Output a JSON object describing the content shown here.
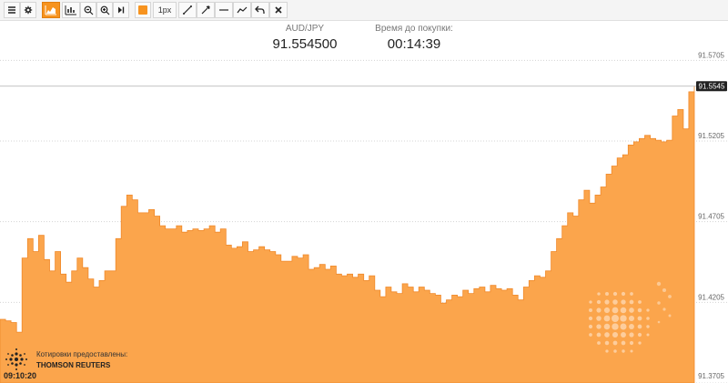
{
  "toolbar": {
    "items": [
      {
        "name": "menu-button",
        "icon": "menu-icon"
      },
      {
        "name": "settings-button",
        "icon": "gear-icon"
      },
      {
        "name": "area-chart-button",
        "icon": "area-chart-icon",
        "active": true
      },
      {
        "name": "bar-chart-button",
        "icon": "bar-chart-icon"
      },
      {
        "name": "zoom-out-button",
        "icon": "zoom-out-icon"
      },
      {
        "name": "zoom-in-button",
        "icon": "zoom-in-icon"
      },
      {
        "name": "skip-to-end-button",
        "icon": "skip-end-icon"
      },
      {
        "name": "color-picker-button",
        "icon": "color-swatch-icon",
        "color": "#f7931e"
      },
      {
        "name": "line-width-button",
        "label": "1px"
      },
      {
        "name": "draw-line-button",
        "icon": "line-icon"
      },
      {
        "name": "draw-ray-button",
        "icon": "ray-icon"
      },
      {
        "name": "horizontal-line-button",
        "icon": "horizontal-line-icon"
      },
      {
        "name": "trend-line-button",
        "icon": "trend-icon"
      },
      {
        "name": "undo-button",
        "icon": "undo-icon"
      },
      {
        "name": "clear-button",
        "icon": "close-icon"
      }
    ],
    "line_width_label": "1px"
  },
  "header": {
    "pair_label": "AUD/JPY",
    "price": "91.554500",
    "timer_label": "Время до покупки:",
    "timer": "00:14:39"
  },
  "credit": {
    "line1": "Котировки предоставлены:",
    "line2": "THOMSON REUTERS"
  },
  "clock": "09:10:20",
  "current_price_tag": "91.5545",
  "colors": {
    "accent": "#f7931e",
    "area_fill": "#fba54c",
    "area_stroke": "#f0892a"
  },
  "chart_data": {
    "type": "area",
    "series": [
      {
        "values": [
          91.41,
          91.409,
          91.408,
          91.402,
          91.448,
          91.46,
          91.452,
          91.462,
          91.447,
          91.44,
          91.452,
          91.438,
          91.433,
          91.44,
          91.448,
          91.442,
          91.435,
          91.43,
          91.434,
          91.44,
          91.44,
          91.46,
          91.48,
          91.487,
          91.484,
          91.476,
          91.476,
          91.478,
          91.474,
          91.468,
          91.466,
          91.466,
          91.468,
          91.464,
          91.465,
          91.466,
          91.465,
          91.466,
          91.468,
          91.464,
          91.466,
          91.456,
          91.454,
          91.455,
          91.458,
          91.452,
          91.453,
          91.455,
          91.453,
          91.452,
          91.45,
          91.446,
          91.446,
          91.449,
          91.448,
          91.45,
          91.441,
          91.442,
          91.444,
          91.441,
          91.443,
          91.438,
          91.437,
          91.438,
          91.436,
          91.438,
          91.434,
          91.437,
          91.428,
          91.424,
          91.43,
          91.427,
          91.426,
          91.432,
          91.43,
          91.427,
          91.43,
          91.428,
          91.426,
          91.425,
          91.42,
          91.422,
          91.425,
          91.424,
          91.428,
          91.426,
          91.429,
          91.43,
          91.427,
          91.431,
          91.429,
          91.428,
          91.429,
          91.425,
          91.422,
          91.43,
          91.434,
          91.437,
          91.436,
          91.44,
          91.452,
          91.46,
          91.468,
          91.476,
          91.474,
          91.484,
          91.49,
          91.482,
          91.487,
          91.492,
          91.5,
          91.505,
          91.51,
          91.512,
          91.518,
          91.52,
          91.522,
          91.524,
          91.522,
          91.521,
          91.52,
          91.521,
          91.536,
          91.54,
          91.528,
          91.551,
          91.5545
        ]
      }
    ],
    "y_ticks": [
      "91.5705",
      "91.5205",
      "91.4705",
      "91.4205",
      "91.3705"
    ],
    "ylim": [
      91.3705,
      91.5955
    ],
    "grid": "horizontal-dotted"
  }
}
